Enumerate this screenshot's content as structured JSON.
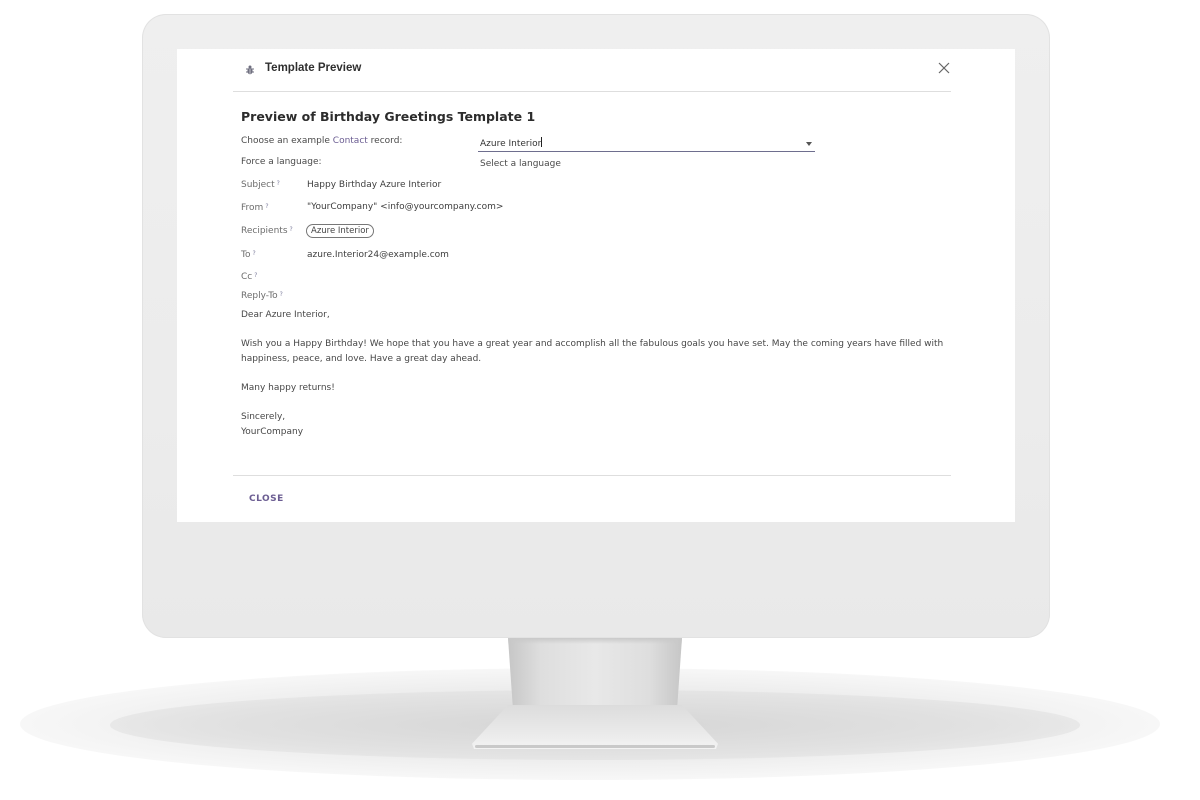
{
  "dialog": {
    "title": "Template Preview",
    "icon": "bug-icon",
    "close_icon": "close-icon"
  },
  "preview": {
    "heading": "Preview of Birthday Greetings Template 1",
    "record_label_prefix": "Choose an example ",
    "record_label_link": "Contact",
    "record_label_suffix": " record:",
    "record_value": "Azure Interior",
    "language_label": "Force a language:",
    "language_placeholder": "Select a language"
  },
  "fields": {
    "subject_label": "Subject",
    "subject_value": "Happy Birthday Azure Interior",
    "from_label": "From",
    "from_value": "\"YourCompany\" <info@yourcompany.com>",
    "recipients_label": "Recipients",
    "recipients_badge": "Azure Interior",
    "to_label": "To",
    "to_value": "azure.Interior24@example.com",
    "cc_label": "Cc",
    "reply_to_label": "Reply-To",
    "help_marker": "?"
  },
  "message": {
    "greeting": "Dear Azure Interior,",
    "para1_line1": "Wish you a Happy Birthday! We hope that you have a great year and accomplish all the fabulous goals you have set. May the coming years have filled with",
    "para1_line2": "happiness, peace, and love. Have a great day ahead.",
    "para2": "Many happy returns!",
    "signoff": "Sincerely,",
    "signature": "YourCompany"
  },
  "footer": {
    "close_label": "CLOSE"
  },
  "colors": {
    "accent": "#6b5d92",
    "screen_bg": "#ffffff",
    "monitor_bezel": "#ececec"
  }
}
